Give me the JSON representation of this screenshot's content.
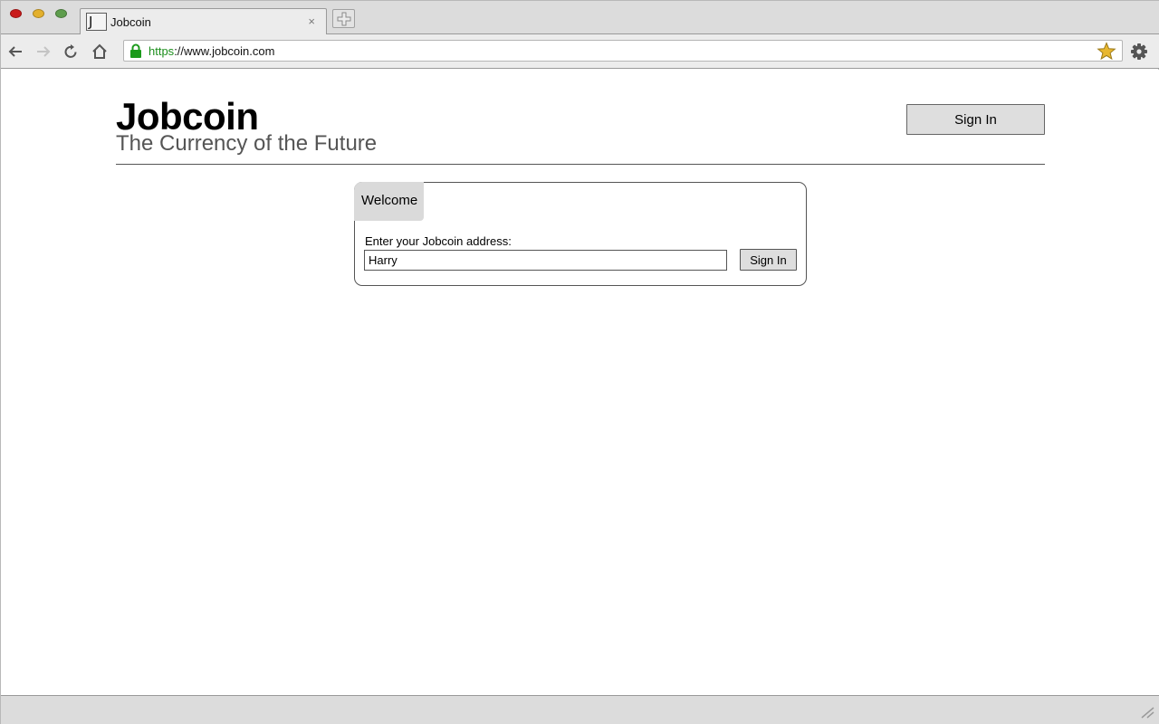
{
  "browser": {
    "tab": {
      "favicon_letter": "J",
      "title": "Jobcoin",
      "close_glyph": "×"
    },
    "url": {
      "scheme": "https",
      "rest": "://www.jobcoin.com"
    },
    "icons": {
      "back": "back-arrow-icon",
      "forward": "forward-arrow-icon",
      "reload": "reload-icon",
      "home": "home-icon",
      "lock": "lock-icon",
      "bookmark": "star-icon",
      "settings": "gear-icon",
      "new_tab": "plus-icon",
      "resize": "resize-grip-icon"
    },
    "colors": {
      "close_light": "#c91a1a",
      "minimize_light": "#e3b02d",
      "maximize_light": "#5e9d4d",
      "secure": "#1b8e1b",
      "star": "#e8b730"
    }
  },
  "header": {
    "brand": "Jobcoin",
    "tagline": "The Currency of the Future",
    "signin_label": "Sign In"
  },
  "login_panel": {
    "tab_label": "Welcome",
    "address_label": "Enter your Jobcoin address:",
    "address_value": "Harry",
    "signin_label": "Sign In"
  }
}
